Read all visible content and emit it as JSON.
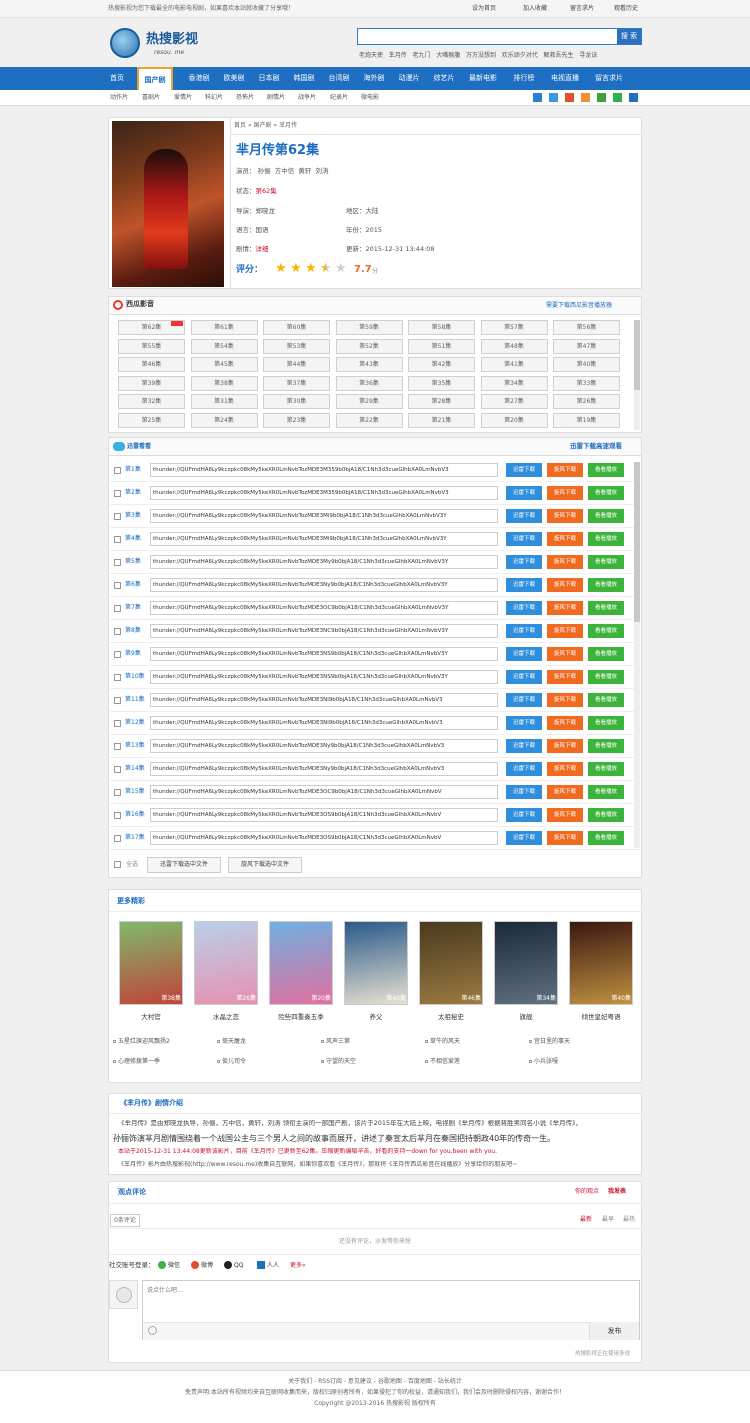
{
  "topbar": {
    "notice": "热搜影视为您下载最全的电影电视剧，如果喜欢本站就收藏了分享哦！",
    "links": [
      "设为首页",
      "加入收藏",
      "留言求片",
      "观看历史"
    ]
  },
  "logo": {
    "name": "热搜影视",
    "sub": "resou. me"
  },
  "search": {
    "placeholder": "",
    "button": "搜 索"
  },
  "hot": [
    "老炮天使",
    "芈月传",
    "老九门",
    "大嘴猴腹",
    "万万没想到",
    "欢乐颂夕对代",
    "解救吾先生",
    "寻龙诀"
  ],
  "nav": [
    "首页",
    "国产剧",
    "香港剧",
    "欧美剧",
    "日本剧",
    "韩国剧",
    "台湾剧",
    "海外剧",
    "动漫片",
    "综艺片",
    "最新电影",
    "排行榜",
    "电视直播",
    "留言求片"
  ],
  "subnav": [
    "动作片",
    "喜剧片",
    "爱情片",
    "科幻片",
    "恐怖片",
    "剧情片",
    "战争片",
    "纪录片",
    "微电影"
  ],
  "detail": {
    "crumb": [
      "首页",
      "»",
      "国产剧",
      "»",
      "芈月传"
    ],
    "title": "芈月传第62集",
    "actors_label": "演员：",
    "actors": [
      "孙俪",
      "方中信",
      "黄轩",
      "刘涛"
    ],
    "status_label": "状态：",
    "status": "第62集",
    "director_label": "导演：",
    "director": "郑晓龙",
    "area_label": "地区：",
    "area": "大陆",
    "lang_label": "语言：",
    "lang": "国语",
    "year_label": "年份：",
    "year": "2015",
    "plot_label": "剧情：",
    "plot": "详细",
    "update_label": "更新：",
    "update": "2015-12-31 13:44:08",
    "rating_label": "评分：",
    "score": "7.7",
    "unit": "分",
    "stars": 3.5
  },
  "xigua": {
    "title": "西瓜影音",
    "tip": "需要下载西瓜影音播放器",
    "episodes": [
      "第62集",
      "第61集",
      "第60集",
      "第59集",
      "第58集",
      "第57集",
      "第56集",
      "第55集",
      "第54集",
      "第53集",
      "第52集",
      "第51集",
      "第48集",
      "第47集",
      "第46集",
      "第45集",
      "第44集",
      "第43集",
      "第42集",
      "第41集",
      "第40集",
      "第39集",
      "第38集",
      "第37集",
      "第36集",
      "第35集",
      "第34集",
      "第33集",
      "第32集",
      "第31集",
      "第30集",
      "第29集",
      "第28集",
      "第27集",
      "第26集",
      "第25集",
      "第24集",
      "第23集",
      "第22集",
      "第21集",
      "第20集",
      "第19集"
    ]
  },
  "xunlei": {
    "title": "迅雷看看",
    "tip": "迅雷下载高速观看",
    "rows": [
      {
        "ep": "第1集",
        "url": "thunder://QUFmdHA6Ly9kczpkc08kMy5keXR0LmNvbTozMDE3M359b0bjA18/C1Nh3d3cueGlhbXA0LmNvbV3"
      },
      {
        "ep": "第2集",
        "url": "thunder://QUFmdHA6Ly9kczpkc08kMy5keXR0LmNvbTozMDE3M359b0bjA18/C1Nh3d3cueGlhbXA0LmNvbV3"
      },
      {
        "ep": "第3集",
        "url": "thunder://QUFmdHA6Ly9kczpkc08kMy5keXR0LmNvbTozMDE3Mi9b0bjA18/C1Nh3d3cueGlhbXA0LmNvbV3Y"
      },
      {
        "ep": "第4集",
        "url": "thunder://QUFmdHA6Ly9kczpkc08kMy5keXR0LmNvbTozMDE3Mi9b0bjA18/C1Nh3d3cueGlhbXA0LmNvbV3Y"
      },
      {
        "ep": "第5集",
        "url": "thunder://QUFmdHA6Ly9kczpkc08kMy5keXR0LmNvbTozMDE3My9b0bjA18/C1Nh3d3cueGlhbXA0LmNvbV3Y"
      },
      {
        "ep": "第6集",
        "url": "thunder://QUFmdHA6Ly9kczpkc08kMy5keXR0LmNvbTozMDE3Ny9b0bjA18/C1Nh3d3cueGlhbXA0LmNvbV3Y"
      },
      {
        "ep": "第7集",
        "url": "thunder://QUFmdHA6Ly9kczpkc08kMy5keXR0LmNvbTozMDE3OC9b0bjA18/C1Nh3d3cueGlhbXA0LmNvbV3Y"
      },
      {
        "ep": "第8集",
        "url": "thunder://QUFmdHA6Ly9kczpkc08kMy5keXR0LmNvbTozMDE3NC9b0bjA18/C1Nh3d3cueGlhbXA0LmNvbV3Y"
      },
      {
        "ep": "第9集",
        "url": "thunder://QUFmdHA6Ly9kczpkc08kMy5keXR0LmNvbTozMDE3NS9b0bjA18/C1Nh3d3cueGlhbXA0LmNvbV3Y"
      },
      {
        "ep": "第10集",
        "url": "thunder://QUFmdHA6Ly9kczpkc08kMy5keXR0LmNvbTozMDE3NS9b0bjA18/C1Nh3d3cueGlhbXA0LmNvbV3Y"
      },
      {
        "ep": "第11集",
        "url": "thunder://QUFmdHA6Ly9kczpkc08kMy5keXR0LmNvbTozMDE3Ni9b0bjA18/C1Nh3d3cueGlhbXA0LmNvbV3"
      },
      {
        "ep": "第12集",
        "url": "thunder://QUFmdHA6Ly9kczpkc08kMy5keXR0LmNvbTozMDE3Ni9b0bjA18/C1Nh3d3cueGlhbXA0LmNvbV3"
      },
      {
        "ep": "第13集",
        "url": "thunder://QUFmdHA6Ly9kczpkc08kMy5keXR0LmNvbTozMDE3Ny9b0bjA18/C1Nh3d3cueGlhbXA0LmNvbV3"
      },
      {
        "ep": "第14集",
        "url": "thunder://QUFmdHA6Ly9kczpkc08kMy5keXR0LmNvbTozMDE3Ny9b0bjA18/C1Nh3d3cueGlhbXA0LmNvbV3"
      },
      {
        "ep": "第15集",
        "url": "thunder://QUFmdHA6Ly9kczpkc08kMy5keXR0LmNvbTozMDE3OC9b0bjA18/C1Nh3d3cueGlhbXA0LmNvbV"
      },
      {
        "ep": "第16集",
        "url": "thunder://QUFmdHA6Ly9kczpkc08kMy5keXR0LmNvbTozMDE3OS9b0bjA18/C1Nh3d3cueGlhbXA0LmNvbV"
      },
      {
        "ep": "第17集",
        "url": "thunder://QUFmdHA6Ly9kczpkc08kMy5keXR0LmNvbTozMDE3OS9b0bjA18/C1Nh3d3cueGlhbXA0LmNvbV"
      }
    ],
    "btn1": "迅雷下载",
    "btn2": "旋风下载",
    "btn3": "看看播放",
    "all_label": "全选",
    "dl_sel1": "迅雷下载选中文件",
    "dl_sel2": "旋风下载选中文件"
  },
  "more": {
    "title": "更多精彩",
    "movies": [
      {
        "name": "大村官",
        "ep": "第38集",
        "c1": "#7fb96a",
        "c2": "#c0443a"
      },
      {
        "name": "水晶之恋",
        "ep": "第26集",
        "c1": "#b8d0ea",
        "c2": "#e890b0"
      },
      {
        "name": "险些四重奏五季",
        "ep": "第20集",
        "c1": "#6fb0e0",
        "c2": "#e070a0"
      },
      {
        "name": "养父",
        "ep": "第40集",
        "c1": "#2a5a8a",
        "c2": "#e8e0d0"
      },
      {
        "name": "太祖秘史",
        "ep": "第46集",
        "c1": "#4a3a20",
        "c2": "#9a7a40"
      },
      {
        "name": "旗舰",
        "ep": "第34集",
        "c1": "#1a2a3a",
        "c2": "#607080"
      },
      {
        "name": "倾世皇妃粤语",
        "ep": "第40集",
        "c1": "#3a1810",
        "c2": "#c09040"
      }
    ],
    "related": [
      "五星红旗迎风飘扬2",
      "倚天屠龙",
      "风声三第",
      "草牛的风天",
      "宫日里的事天",
      "心理修拨第一季",
      "俊儿司令",
      "守望的天空",
      "不相信爱莲",
      "小兵张嘎"
    ]
  },
  "plot": {
    "title": "《芈月传》剧情介绍",
    "line1": "《芈月传》是由郑晓龙执导，孙俪，方中信，黄轩，刘涛 领衔主演的一部国产剧，该片于2015年在大陆上映，电视剧《芈月传》根据蒋胜男同名小说《芈月传》，",
    "line2": "孙俪饰演芈月剧情围绕着一个战国公主与三个男人之间的故事而展开，讲述了秦宣太后芈月在秦国把持朝政40年的传奇一生。",
    "line3": "本站于2015-12-31 13:44:08更新该影片，目前《芈月传》已更新至62集。压缩更新编辑辛苦，好看的支持一down for you,been with you.",
    "line4": "《芈月传》影片由热搜影视(http://www.resou.me)收集自互联网，如果你喜欢看《芈月传》，那就将《芈月传西瓜影音在线播放》分享给你的朋友吧~"
  },
  "comment": {
    "title": "观点评论",
    "mine": "你的观点",
    "publish": "我发表",
    "count": "0条评论",
    "sort": [
      "最新",
      "最早",
      "最热"
    ],
    "empty": "还没有评论，沙发等你来抢",
    "login_label": "社交账号登录：",
    "logins": [
      "微信",
      "微博",
      "QQ",
      "人人",
      "更多»"
    ],
    "placeholder": "说点什么吧...",
    "submit": "发布",
    "powered": "热搜影视正在使用多说"
  },
  "footer": {
    "links": "关于我们 - RSS订阅 - 意见建议 - 谷歌地图 - 百度地图 - 站长统计",
    "disclaimer": "免责声明:本站所有视频均来自互联网收集而来，版权归原创者所有，如果侵犯了你的权益，请通知我们，我们会及时删除侵权内容，谢谢合作！",
    "copyright": "Copyright @2013-2016 热搜影视 版权所有"
  },
  "colors": {
    "brand": "#1e6fc1",
    "accent": "#c8102e",
    "xunlei": "#2f8fdc",
    "xuanfeng": "#f06a20",
    "kankan": "#3cb43c"
  }
}
